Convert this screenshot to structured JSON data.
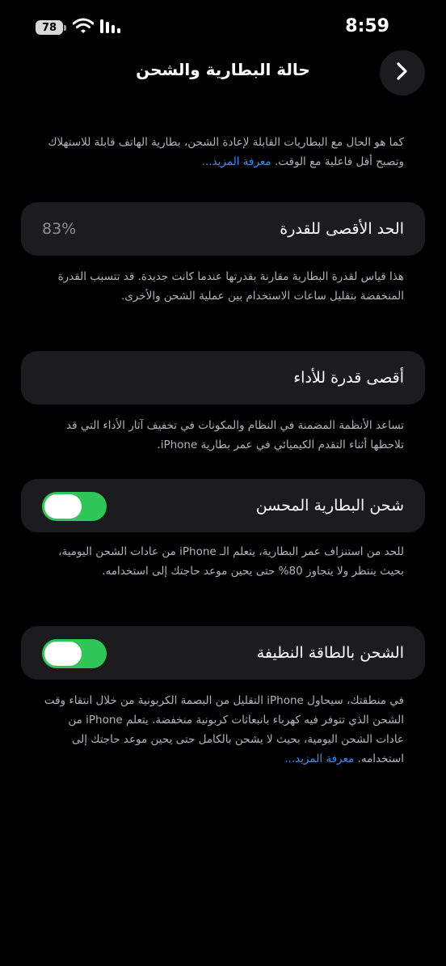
{
  "status_bar": {
    "time": "8:59",
    "battery_level": "78",
    "icons": [
      "battery-icon",
      "wifi-icon",
      "cellular-signal-icon"
    ]
  },
  "nav": {
    "title": "حالة البطارية والشحن",
    "back_icon": "chevron-right-icon"
  },
  "intro": {
    "text": "كما هو الحال مع البطاريات القابلة لإعادة الشحن، بطارية الهاتف قابلة للاستهلاك وتصبح أقل فاعلية مع الوقت.",
    "link": "معرفة المزيد..."
  },
  "maximum_capacity": {
    "label": "الحد الأقصى للقدرة",
    "value": "83%",
    "description": "هذا قياس لقدرة البطارية مقارنة بقدرتها عندما كانت جديدة. قد تتسبب القدرة المنخفضة بتقليل ساعات الاستخدام بين عملية الشحن والأخرى."
  },
  "peak_performance": {
    "label": "أقصى قدرة للأداء",
    "description": "تساعد الأنظمة المضمنة في النظام والمكونات في تخفيف آثار الأداء التي قد تلاحظها أثناء التقدم الكيميائي في عمر بطارية iPhone."
  },
  "optimized_charging": {
    "label": "شحن البطارية المحسن",
    "enabled": true,
    "description": "للحد من استنزاف عمر البطارية، يتعلم الـ iPhone من عادات الشحن اليومية، بحيث ينتظر ولا يتجاوز 80% حتى يحين موعد حاجتك إلى استخدامه."
  },
  "clean_energy_charging": {
    "label": "الشحن بالطاقة النظيفة",
    "enabled": true,
    "description": "في منطقتك، سيحاول iPhone التقليل من البصمة الكربونية من خلال انتقاء وقت الشحن الذي تتوفر فيه كهرباء بانبعاثات كربونية منخفضة. يتعلم iPhone من عادات الشحن اليومية، بحيث لا يشحن بالكامل حتى يحين موعد حاجتك إلى استخدامه.",
    "link": "معرفة المزيد..."
  },
  "colors": {
    "background": "#000000",
    "card": "#1c1c1e",
    "toggle_on": "#30c758",
    "link": "#3a8ef6",
    "secondary_text": "#b4b4b8"
  }
}
